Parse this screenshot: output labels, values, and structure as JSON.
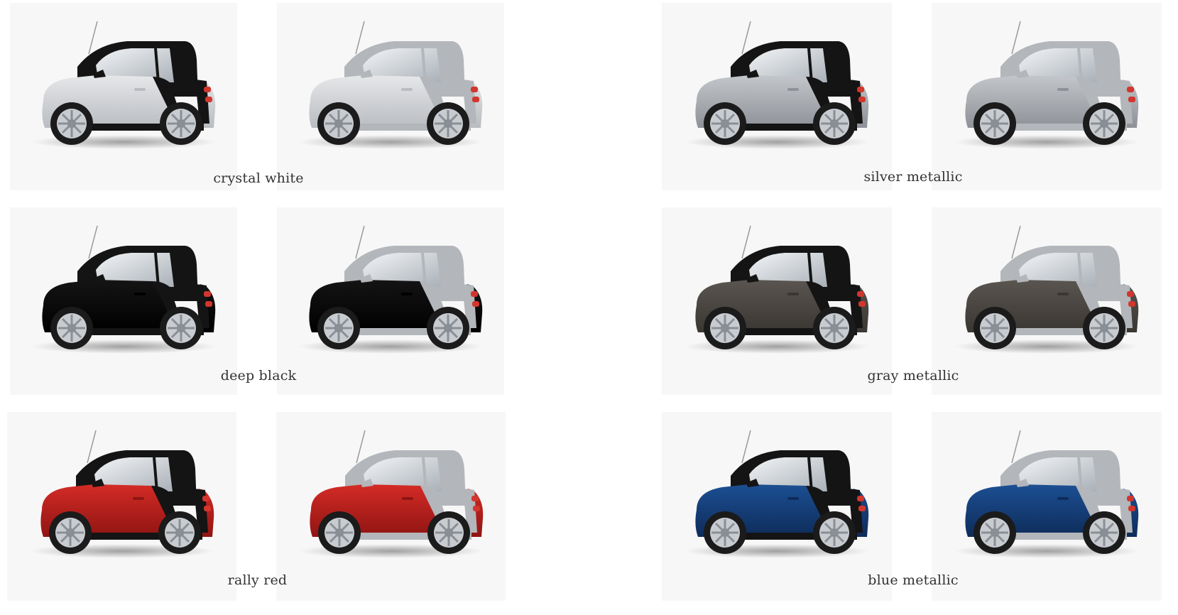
{
  "swatches": [
    {
      "label": "crystal white",
      "body": "#e6e7e9",
      "shade": "#b9bcc1",
      "cell": "#1a1a1a"
    },
    {
      "label": "silver metallic",
      "body": "#c3c6ca",
      "shade": "#8e9298",
      "cell": "#1a1a1a"
    },
    {
      "label": "deep black",
      "body": "#141414",
      "shade": "#000000",
      "cell": "#1a1a1a"
    },
    {
      "label": "gray metallic",
      "body": "#5a5550",
      "shade": "#3a3632",
      "cell": "#1a1a1a"
    },
    {
      "label": "rally red",
      "body": "#d42b26",
      "shade": "#8f1512",
      "cell": "#1a1a1a"
    },
    {
      "label": "blue metallic",
      "body": "#1c4f93",
      "shade": "#0e2c5a",
      "cell": "#1a1a1a"
    }
  ],
  "tridion": {
    "black": "#141414",
    "silver": "#b3b6ba"
  }
}
